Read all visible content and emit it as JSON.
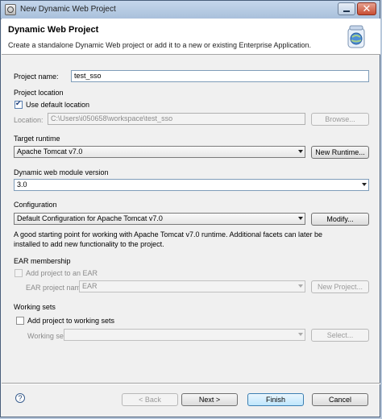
{
  "window": {
    "title": "New Dynamic Web Project"
  },
  "header": {
    "title": "Dynamic Web Project",
    "description": "Create a standalone Dynamic Web project or add it to a new or existing Enterprise Application."
  },
  "project_name": {
    "label": "Project name:",
    "value": "test_sso"
  },
  "project_location": {
    "group_label": "Project location",
    "use_default_label": "Use default location",
    "use_default_checked": true,
    "location_label": "Location:",
    "location_value": "C:\\Users\\i050658\\workspace\\test_sso",
    "browse_label": "Browse..."
  },
  "target_runtime": {
    "label": "Target runtime",
    "value": "Apache Tomcat v7.0",
    "new_runtime_label": "New Runtime..."
  },
  "module_version": {
    "label": "Dynamic web module version",
    "value": "3.0"
  },
  "configuration": {
    "label": "Configuration",
    "value": "Default Configuration for Apache Tomcat v7.0",
    "modify_label": "Modify...",
    "description_line1": "A good starting point for working with Apache Tomcat v7.0 runtime. Additional facets can later be",
    "description_line2": "installed to add new functionality to the project."
  },
  "ear": {
    "group_label": "EAR membership",
    "add_label": "Add project to an EAR",
    "add_checked": false,
    "name_label": "EAR project name:",
    "name_value": "EAR",
    "new_project_label": "New Project..."
  },
  "working_sets": {
    "group_label": "Working sets",
    "add_label": "Add project to working sets",
    "add_checked": false,
    "sets_label": "Working sets:",
    "sets_value": "",
    "select_label": "Select..."
  },
  "footer": {
    "help_icon": "?",
    "back_label": "< Back",
    "next_label": "Next >",
    "finish_label": "Finish",
    "cancel_label": "Cancel"
  },
  "colors": {
    "title_bar": "#a9c0db",
    "close_button": "#c74d33",
    "default_button": "#bee6fd"
  },
  "icons": [
    "app-window-icon",
    "minimize-icon",
    "close-icon",
    "wizard-globe-jar-icon",
    "help-icon",
    "dropdown-arrow-icon"
  ]
}
